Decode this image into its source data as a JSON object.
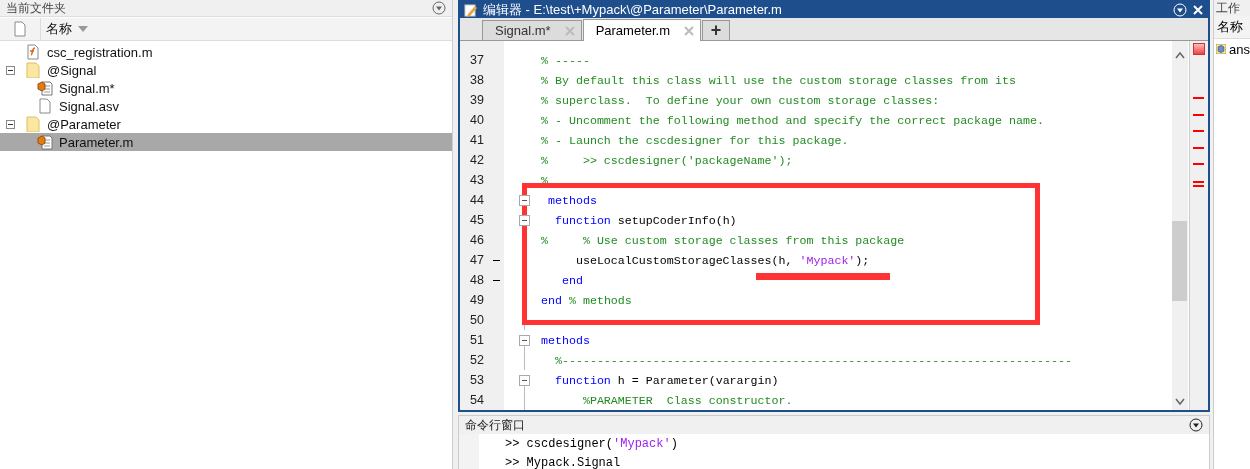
{
  "file_browser": {
    "title": "当前文件夹",
    "column": "名称",
    "tree": [
      {
        "kind": "function",
        "name": "csc_registration.m",
        "selected": false
      },
      {
        "kind": "folder",
        "name": "@Signal",
        "expanded": true,
        "selected": false,
        "children": [
          {
            "kind": "class",
            "name": "Signal.m*",
            "selected": false
          },
          {
            "kind": "file",
            "name": "Signal.asv",
            "selected": false
          }
        ]
      },
      {
        "kind": "folder",
        "name": "@Parameter",
        "expanded": true,
        "selected": false,
        "children": [
          {
            "kind": "class",
            "name": "Parameter.m",
            "selected": true
          }
        ]
      }
    ]
  },
  "editor": {
    "title": "编辑器 - E:\\test\\+Mypack\\@Parameter\\Parameter.m",
    "tabs": [
      {
        "label": "Signal.m*",
        "selected": false
      },
      {
        "label": "Parameter.m",
        "selected": true
      }
    ],
    "add_tab": "+",
    "lines": [
      {
        "number": "37",
        "kind": "plain",
        "changed": false,
        "tokens": [
          {
            "kind": "comment",
            "text": "% -----"
          }
        ]
      },
      {
        "number": "38",
        "kind": "plain",
        "changed": false,
        "tokens": [
          {
            "kind": "comment",
            "text": "% By default this class will use the custom storage classes from its"
          }
        ]
      },
      {
        "number": "39",
        "kind": "plain",
        "changed": false,
        "tokens": [
          {
            "kind": "comment",
            "text": "% superclass.  To define your own custom storage classes:"
          }
        ]
      },
      {
        "number": "40",
        "kind": "plain",
        "changed": false,
        "tokens": [
          {
            "kind": "comment",
            "text": "% - Uncomment the following method and specify the correct package name."
          }
        ]
      },
      {
        "number": "41",
        "kind": "plain",
        "changed": false,
        "tokens": [
          {
            "kind": "comment",
            "text": "% - Launch the cscdesigner for this package."
          }
        ]
      },
      {
        "number": "42",
        "kind": "plain",
        "changed": false,
        "tokens": [
          {
            "kind": "comment",
            "text": "%     >> cscdesigner('packageName');"
          }
        ]
      },
      {
        "number": "43",
        "kind": "plain",
        "changed": false,
        "tokens": [
          {
            "kind": "comment",
            "text": "%"
          }
        ]
      },
      {
        "number": "44",
        "kind": "fold_start",
        "changed": false,
        "tokens": [
          {
            "kind": "keyword",
            "text": " methods"
          }
        ]
      },
      {
        "number": "45",
        "kind": "fold_start",
        "changed": false,
        "tokens": [
          {
            "kind": "keyword",
            "text": "  function"
          },
          {
            "kind": "plain",
            "text": " setupCoderInfo(h)"
          }
        ]
      },
      {
        "number": "46",
        "kind": "fold_body",
        "changed": false,
        "tokens": [
          {
            "kind": "comment",
            "text": "%     % Use custom storage classes from this package"
          }
        ]
      },
      {
        "number": "47",
        "kind": "fold_body",
        "changed": true,
        "tokens": [
          {
            "kind": "plain",
            "text": "     useLocalCustomStorageClasses(h, "
          },
          {
            "kind": "string",
            "text": "'Mypack'"
          },
          {
            "kind": "plain",
            "text": ");"
          }
        ]
      },
      {
        "number": "48",
        "kind": "fold_body",
        "changed": true,
        "tokens": [
          {
            "kind": "keyword",
            "text": "   end"
          }
        ]
      },
      {
        "number": "49",
        "kind": "fold_body",
        "changed": false,
        "tokens": [
          {
            "kind": "keyword",
            "text": "end"
          },
          {
            "kind": "comment",
            "text": " % methods"
          }
        ]
      },
      {
        "number": "50",
        "kind": "fold_body",
        "changed": false
      },
      {
        "number": "51",
        "kind": "fold_start",
        "changed": false,
        "tokens": [
          {
            "kind": "keyword",
            "text": "methods"
          }
        ]
      },
      {
        "number": "52",
        "kind": "fold_body",
        "changed": false,
        "tokens": [
          {
            "kind": "comment",
            "text": "  %-------------------------------------------------------------------------"
          }
        ]
      },
      {
        "number": "53",
        "kind": "fold_start",
        "changed": false,
        "tokens": [
          {
            "kind": "keyword",
            "text": "  function"
          },
          {
            "kind": "plain",
            "text": " h = Parameter(varargin)"
          }
        ]
      },
      {
        "number": "54",
        "kind": "fold_body",
        "changed": false,
        "tokens": [
          {
            "kind": "comment",
            "text": "      %PARAMETER  Class constructor."
          }
        ]
      }
    ]
  },
  "command_window": {
    "title": "命令行窗口",
    "lines": [
      {
        "tokens": [
          {
            "kind": "plain",
            "text": ">> cscdesigner("
          },
          {
            "kind": "string",
            "text": "'Mypack'"
          },
          {
            "kind": "plain",
            "text": ")"
          }
        ]
      },
      {
        "tokens": [
          {
            "kind": "plain",
            "text": ">> Mypack.Signal"
          }
        ]
      }
    ]
  },
  "workspace": {
    "title": "工作",
    "column": "名称",
    "items": [
      {
        "name": "ans"
      }
    ]
  }
}
